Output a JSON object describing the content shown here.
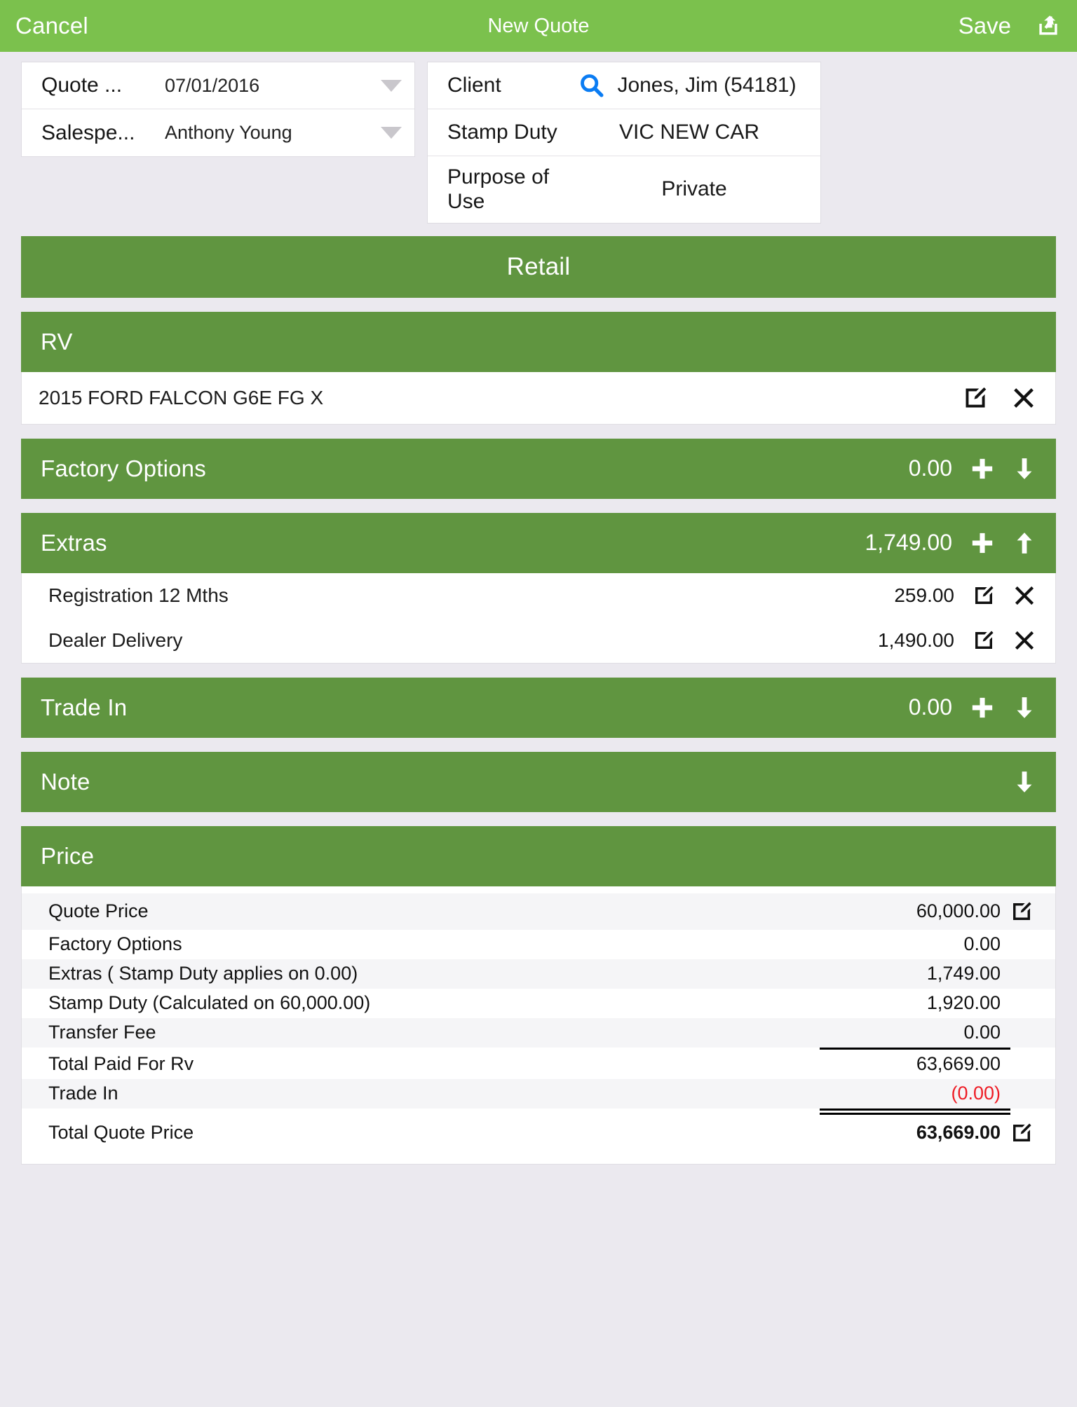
{
  "navbar": {
    "cancel_label": "Cancel",
    "title": "New Quote",
    "save_label": "Save",
    "share_icon": "share-icon"
  },
  "quote_form": {
    "rows": [
      {
        "label": "Quote ...",
        "value": "07/01/2016",
        "control": "dropdown-caret"
      },
      {
        "label": "Salespe...",
        "value": "Anthony Young",
        "control": "dropdown-caret"
      }
    ]
  },
  "client_form": {
    "rows": [
      {
        "label": "Client",
        "value": "Jones, Jim (54181)",
        "icon": "search-icon"
      },
      {
        "label": "Stamp Duty",
        "value": "VIC NEW CAR",
        "icon": ""
      },
      {
        "label": "Purpose of Use",
        "value": "Private",
        "icon": ""
      }
    ]
  },
  "retail_banner": {
    "title": "Retail"
  },
  "sections": {
    "rv": {
      "title": "RV",
      "item": {
        "text": "2015 FORD FALCON G6E FG X",
        "edit_icon": "edit-icon",
        "delete_icon": "close-icon"
      }
    },
    "factory_options": {
      "title": "Factory Options",
      "amount": "0.00",
      "add_icon": "plus-icon",
      "toggle_icon": "arrow-down-icon"
    },
    "extras": {
      "title": "Extras",
      "amount": "1,749.00",
      "add_icon": "plus-icon",
      "toggle_icon": "arrow-up-icon",
      "items": [
        {
          "label": "Registration 12 Mths",
          "amount": "259.00",
          "edit_icon": "edit-icon",
          "delete_icon": "close-icon"
        },
        {
          "label": "Dealer Delivery",
          "amount": "1,490.00",
          "edit_icon": "edit-icon",
          "delete_icon": "close-icon"
        }
      ]
    },
    "trade_in": {
      "title": "Trade In",
      "amount": "0.00",
      "add_icon": "plus-icon",
      "toggle_icon": "arrow-down-icon"
    },
    "note": {
      "title": "Note",
      "toggle_icon": "arrow-down-icon"
    },
    "price": {
      "title": "Price",
      "rows": [
        {
          "label": "Quote Price",
          "value": "60,000.00",
          "icon": "edit-icon",
          "negative": false,
          "bold": false
        },
        {
          "label": "Factory Options",
          "value": "0.00",
          "icon": "",
          "negative": false,
          "bold": false
        },
        {
          "label": "Extras ( Stamp Duty applies on 0.00)",
          "value": "1,749.00",
          "icon": "",
          "negative": false,
          "bold": false
        },
        {
          "label": "Stamp Duty (Calculated on 60,000.00)",
          "value": "1,920.00",
          "icon": "",
          "negative": false,
          "bold": false
        },
        {
          "label": "Transfer Fee",
          "value": "0.00",
          "icon": "",
          "negative": false,
          "bold": false
        },
        {
          "label": "Total Paid For Rv",
          "value": "63,669.00",
          "icon": "",
          "negative": false,
          "bold": false
        },
        {
          "label": "Trade In",
          "value": "(0.00)",
          "icon": "",
          "negative": true,
          "bold": false
        },
        {
          "label": "Total Quote Price",
          "value": "63,669.00",
          "icon": "edit-icon",
          "negative": false,
          "bold": true
        }
      ]
    }
  },
  "colors": {
    "nav_green": "#7bc14d",
    "section_green": "#609540",
    "page_bg": "#ebe9ef",
    "accent_blue": "#0a7cf3",
    "negative_red": "#ee1c25"
  }
}
